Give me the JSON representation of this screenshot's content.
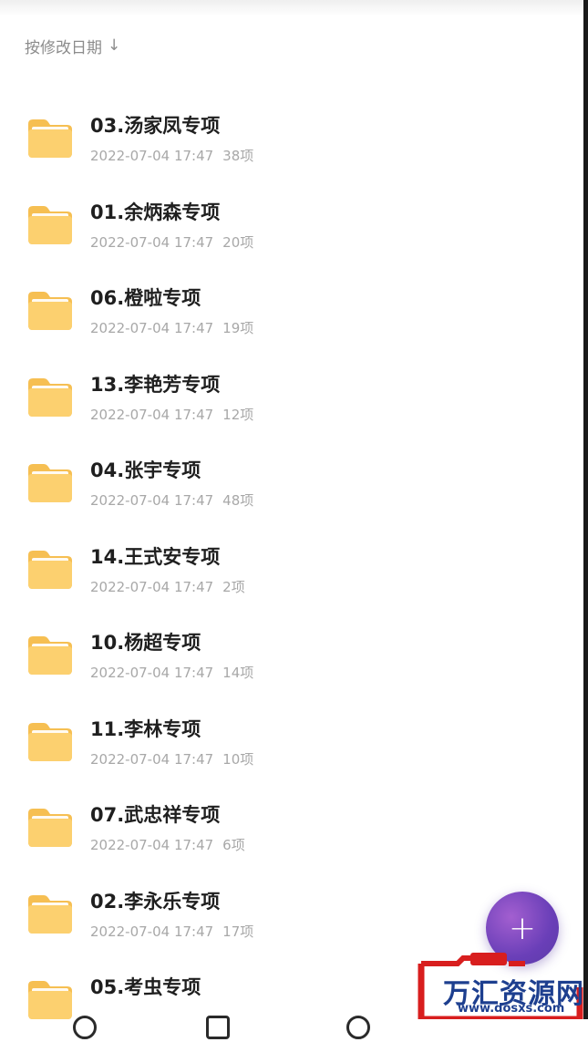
{
  "sort": {
    "label": "按修改日期",
    "direction_icon": "arrow-down-icon"
  },
  "folders": [
    {
      "name": "03.汤家凤专项",
      "date": "2022-07-04 17:47",
      "count": "38项"
    },
    {
      "name": "01.余炳森专项",
      "date": "2022-07-04 17:47",
      "count": "20项"
    },
    {
      "name": "06.橙啦专项",
      "date": "2022-07-04 17:47",
      "count": "19项"
    },
    {
      "name": "13.李艳芳专项",
      "date": "2022-07-04 17:47",
      "count": "12项"
    },
    {
      "name": "04.张宇专项",
      "date": "2022-07-04 17:47",
      "count": "48项"
    },
    {
      "name": "14.王式安专项",
      "date": "2022-07-04 17:47",
      "count": "2项"
    },
    {
      "name": "10.杨超专项",
      "date": "2022-07-04 17:47",
      "count": "14项"
    },
    {
      "name": "11.李林专项",
      "date": "2022-07-04 17:47",
      "count": "10项"
    },
    {
      "name": "07.武忠祥专项",
      "date": "2022-07-04 17:47",
      "count": "6项"
    },
    {
      "name": "02.李永乐专项",
      "date": "2022-07-04 17:47",
      "count": "17项"
    },
    {
      "name": "05.考虫专项",
      "date": "",
      "count": ""
    }
  ],
  "fab": {
    "icon": "plus-icon",
    "label": "+"
  },
  "watermark": {
    "title": "万汇资源网",
    "url": "www.dosxs.com"
  },
  "colors": {
    "folder": "#fcd06f",
    "folder_tab": "#f6bf52",
    "fab": "#6a3fb8",
    "watermark": "#d81e1e"
  }
}
